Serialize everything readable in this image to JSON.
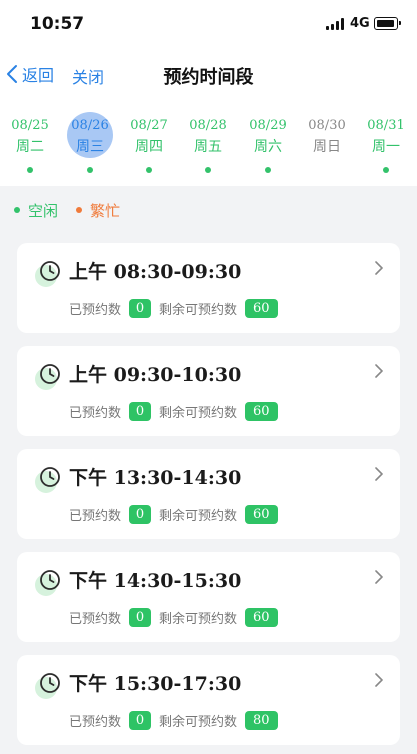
{
  "status_bar": {
    "time": "10:57",
    "network": "4G"
  },
  "nav": {
    "back_label": "返回",
    "close_label": "关闭",
    "title": "预约时间段"
  },
  "dates": [
    {
      "md": "08/25",
      "wd": "周二",
      "state": "free",
      "dot": true
    },
    {
      "md": "08/26",
      "wd": "周三",
      "state": "selected",
      "dot": true
    },
    {
      "md": "08/27",
      "wd": "周四",
      "state": "free",
      "dot": true
    },
    {
      "md": "08/28",
      "wd": "周五",
      "state": "free",
      "dot": true
    },
    {
      "md": "08/29",
      "wd": "周六",
      "state": "free",
      "dot": true
    },
    {
      "md": "08/30",
      "wd": "周日",
      "state": "none",
      "dot": false
    },
    {
      "md": "08/31",
      "wd": "周一",
      "state": "free",
      "dot": true
    }
  ],
  "legend": {
    "free_label": "空闲",
    "busy_label": "繁忙",
    "free_color": "#33c26b",
    "busy_color": "#f07a3a"
  },
  "slots": [
    {
      "time": "上午 08:30-09:30",
      "booked_label": "已预约数",
      "booked": "0",
      "remain_label": "剩余可预约数",
      "remain": "60"
    },
    {
      "time": "上午 09:30-10:30",
      "booked_label": "已预约数",
      "booked": "0",
      "remain_label": "剩余可预约数",
      "remain": "60"
    },
    {
      "time": "下午 13:30-14:30",
      "booked_label": "已预约数",
      "booked": "0",
      "remain_label": "剩余可预约数",
      "remain": "60"
    },
    {
      "time": "下午 14:30-15:30",
      "booked_label": "已预约数",
      "booked": "0",
      "remain_label": "剩余可预约数",
      "remain": "60"
    },
    {
      "time": "下午 15:30-17:30",
      "booked_label": "已预约数",
      "booked": "0",
      "remain_label": "剩余可预约数",
      "remain": "80"
    }
  ],
  "icons": {
    "back": "chevron-left-icon",
    "slot": "clock-icon",
    "arrow": "chevron-right-icon"
  },
  "colors": {
    "accent": "#2a82e4",
    "green": "#33c26b",
    "busy": "#f07a3a",
    "badge": "#2ec365"
  }
}
